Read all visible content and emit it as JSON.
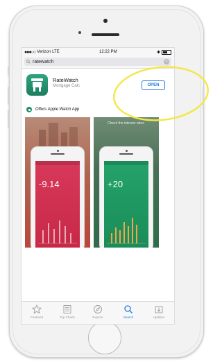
{
  "status": {
    "carrier": "Verizon",
    "network": "LTE",
    "time": "12:22 PM"
  },
  "search": {
    "query": "ratewatch"
  },
  "app": {
    "name": "RateWatch",
    "subtitle": "Mortgage Calc",
    "open_label": "OPEN",
    "watch_label": "Offers Apple Watch App"
  },
  "screenshots": [
    {
      "caption": "",
      "big_value": "-9.14",
      "small_value": ""
    },
    {
      "caption": "Check the interest rates",
      "big_value": "+20",
      "small_value": ""
    }
  ],
  "tabs": [
    {
      "label": "Featured",
      "icon": "star-icon"
    },
    {
      "label": "Top Charts",
      "icon": "list-icon"
    },
    {
      "label": "Explore",
      "icon": "compass-icon"
    },
    {
      "label": "Search",
      "icon": "search-icon",
      "active": true
    },
    {
      "label": "Updates",
      "icon": "download-icon"
    }
  ],
  "colors": {
    "accent": "#1f7ae0",
    "app_green": "#1d8f63",
    "annotation_yellow": "#f2e84a"
  }
}
